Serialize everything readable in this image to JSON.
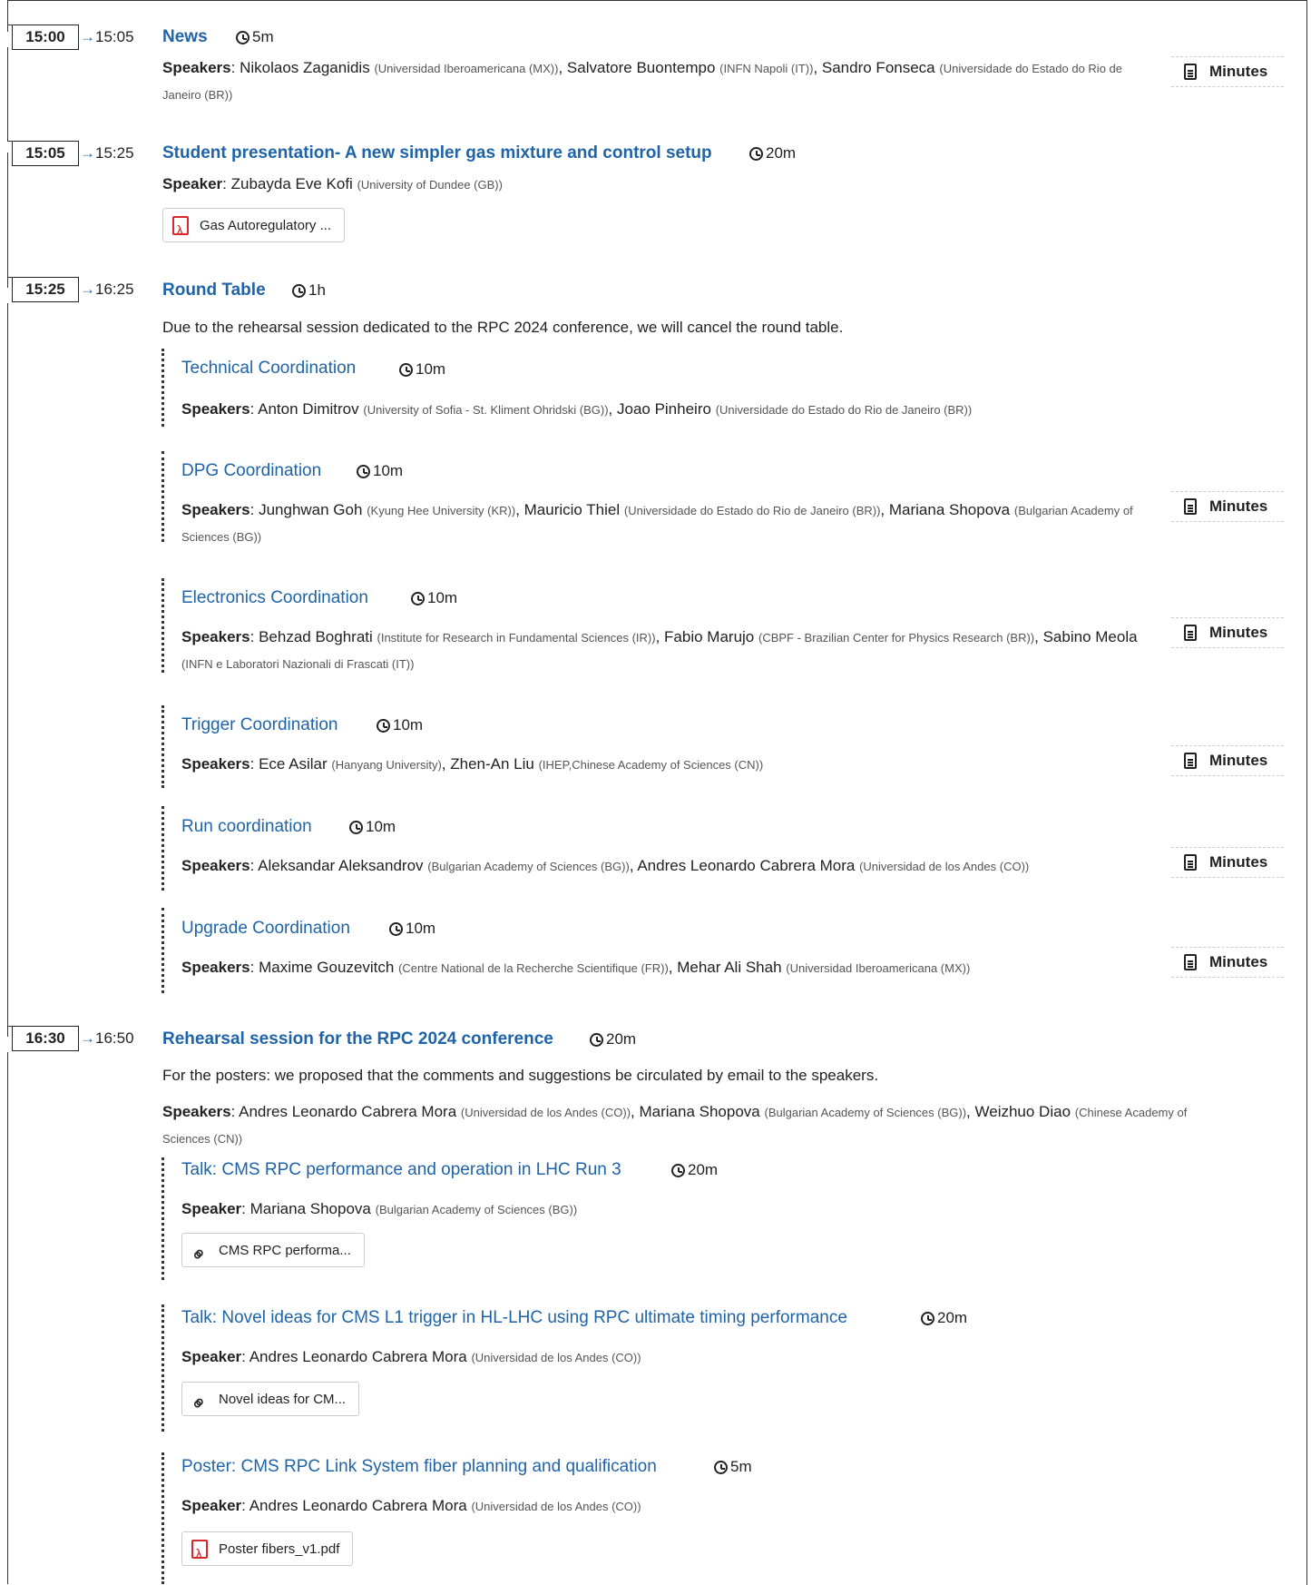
{
  "minutes_label": "Minutes",
  "entries": [
    {
      "start": "15:00",
      "end": "15:05",
      "title": "News",
      "duration": "5m",
      "speakers_label": "Speakers",
      "speakers": [
        {
          "name": "Nikolaos Zaganidis",
          "aff": "(Universidad Iberoamericana (MX))"
        },
        {
          "name": "Salvatore Buontempo",
          "aff": "(INFN Napoli (IT))"
        },
        {
          "name": "Sandro Fonseca",
          "aff": "(Universidade do Estado do Rio de Janeiro (BR))"
        }
      ]
    },
    {
      "start": "15:05",
      "end": "15:25",
      "title": "Student presentation- A new simpler gas mixture and control setup",
      "duration": "20m",
      "speakers_label": "Speaker",
      "speakers": [
        {
          "name": "Zubayda Eve Kofi",
          "aff": "(University of Dundee (GB))"
        }
      ],
      "attachment": "Gas Autoregulatory ..."
    },
    {
      "start": "15:25",
      "end": "16:25",
      "title": "Round Table",
      "duration": "1h",
      "description": "Due to the rehearsal session dedicated to the RPC 2024 conference, we will cancel the round table.",
      "subs": [
        {
          "title": "Technical Coordination",
          "duration": "10m",
          "speakers_label": "Speakers",
          "speakers": [
            {
              "name": "Anton Dimitrov",
              "aff": "(University of Sofia - St. Kliment Ohridski (BG))"
            },
            {
              "name": "Joao Pinheiro",
              "aff": "(Universidade do Estado do Rio de Janeiro (BR))"
            }
          ]
        },
        {
          "title": "DPG Coordination",
          "duration": "10m",
          "speakers_label": "Speakers",
          "speakers": [
            {
              "name": "Junghwan Goh",
              "aff": "(Kyung Hee University (KR))"
            },
            {
              "name": "Mauricio Thiel",
              "aff": "(Universidade do Estado do Rio de Janeiro (BR))"
            },
            {
              "name": "Mariana Shopova",
              "aff": "(Bulgarian Academy of Sciences (BG))"
            }
          ]
        },
        {
          "title": "Electronics Coordination",
          "duration": "10m",
          "speakers_label": "Speakers",
          "speakers": [
            {
              "name": "Behzad Boghrati",
              "aff": "(Institute for Research in Fundamental Sciences (IR))"
            },
            {
              "name": "Fabio Marujo",
              "aff": "(CBPF - Brazilian Center for Physics Research (BR))"
            },
            {
              "name": "Sabino Meola",
              "aff": "(INFN e Laboratori Nazionali di Frascati (IT))"
            }
          ]
        },
        {
          "title": "Trigger Coordination",
          "duration": "10m",
          "speakers_label": "Speakers",
          "speakers": [
            {
              "name": "Ece Asilar",
              "aff": "(Hanyang University)"
            },
            {
              "name": "Zhen-An Liu",
              "aff": "(IHEP,Chinese Academy of Sciences (CN))"
            }
          ]
        },
        {
          "title": "Run coordination",
          "duration": "10m",
          "speakers_label": "Speakers",
          "speakers": [
            {
              "name": "Aleksandar Aleksandrov",
              "aff": "(Bulgarian Academy of Sciences (BG))"
            },
            {
              "name": "Andres Leonardo Cabrera Mora",
              "aff": "(Universidad de los Andes (CO))"
            }
          ]
        },
        {
          "title": "Upgrade Coordination",
          "duration": "10m",
          "speakers_label": "Speakers",
          "speakers": [
            {
              "name": "Maxime Gouzevitch",
              "aff": "(Centre National de la Recherche Scientifique (FR))"
            },
            {
              "name": "Mehar Ali Shah",
              "aff": "(Universidad Iberoamericana (MX))"
            }
          ]
        }
      ]
    },
    {
      "start": "16:30",
      "end": "16:50",
      "title": "Rehearsal session for the RPC 2024 conference",
      "duration": "20m",
      "description": "For the posters: we proposed that the comments and suggestions be circulated by email to the speakers.",
      "speakers_label": "Speakers",
      "speakers": [
        {
          "name": "Andres Leonardo Cabrera Mora",
          "aff": "(Universidad de los Andes (CO))"
        },
        {
          "name": "Mariana Shopova",
          "aff": "(Bulgarian Academy of Sciences (BG))"
        },
        {
          "name": "Weizhuo Diao",
          "aff": "(Chinese Academy of Sciences (CN))"
        }
      ],
      "subs": [
        {
          "title": "Talk: CMS RPC performance and operation in LHC Run 3",
          "duration": "20m",
          "speakers_label": "Speaker",
          "speakers": [
            {
              "name": "Mariana Shopova",
              "aff": "(Bulgarian Academy of Sciences (BG))"
            }
          ],
          "attachment": "CMS RPC performa..."
        },
        {
          "title": "Talk: Novel ideas for CMS L1 trigger in HL-LHC using RPC ultimate timing performance",
          "duration": "20m",
          "speakers_label": "Speaker",
          "speakers": [
            {
              "name": "Andres Leonardo Cabrera Mora",
              "aff": "(Universidad de los Andes (CO))"
            }
          ],
          "attachment": "Novel ideas for CM..."
        },
        {
          "title": "Poster: CMS RPC Link System fiber planning and qualification",
          "duration": "5m",
          "speakers_label": "Speaker",
          "speakers": [
            {
              "name": "Andres Leonardo Cabrera Mora",
              "aff": "(Universidad de los Andes (CO))"
            }
          ],
          "attachment": "Poster fibers_v1.pdf"
        }
      ]
    }
  ],
  "arrow": "→",
  "sep": ", ",
  "colon": ": "
}
